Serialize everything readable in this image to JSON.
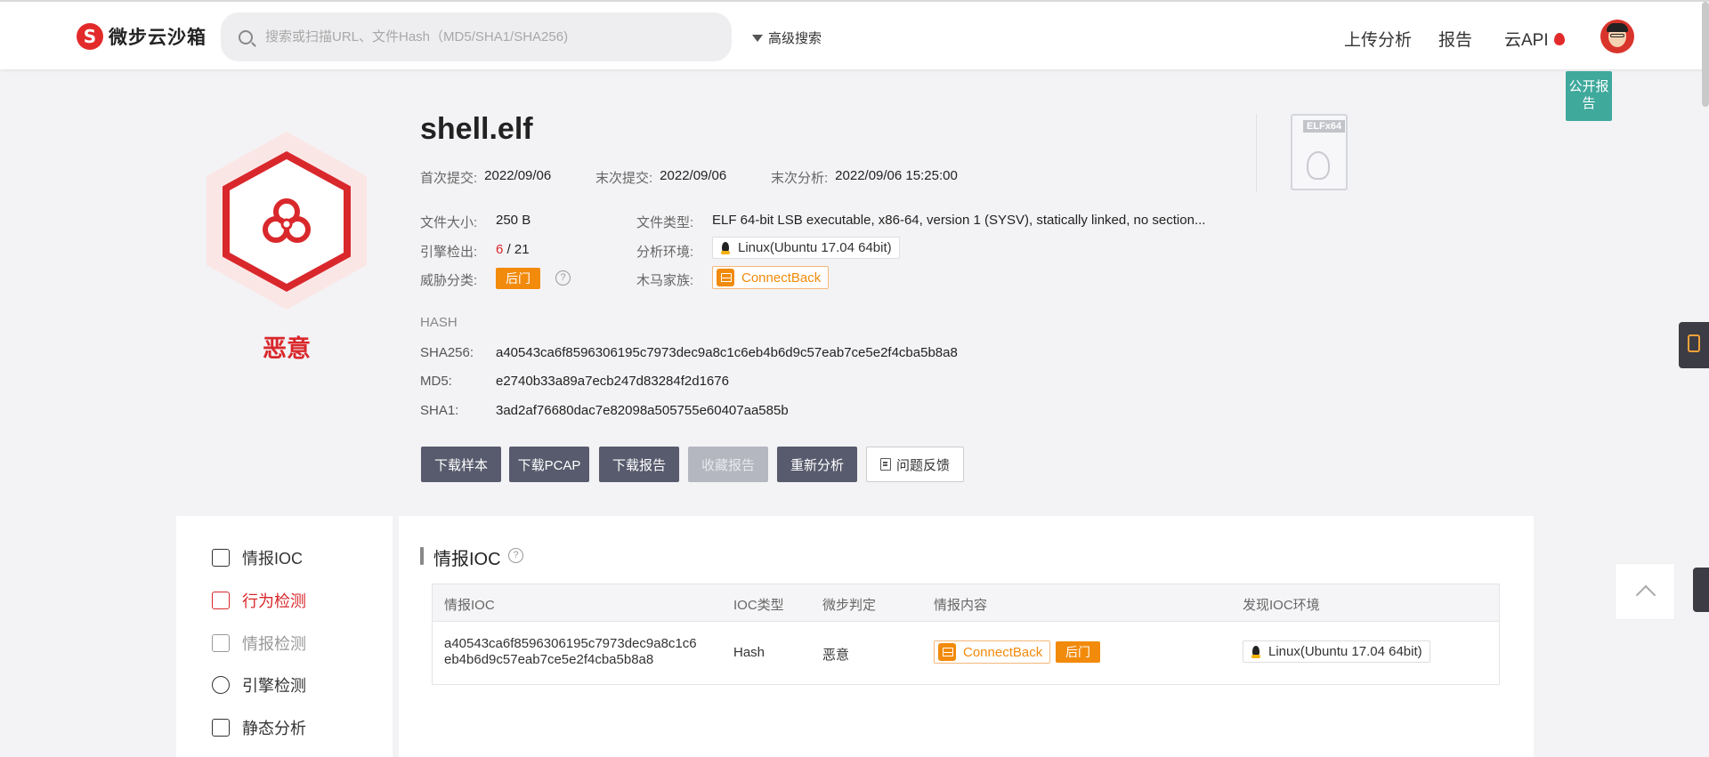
{
  "nav": {
    "logo_text": "微步云沙箱",
    "search_placeholder": "搜索或扫描URL、文件Hash（MD5/SHA1/SHA256)",
    "advanced_search": "高级搜索",
    "upload": "上传分析",
    "report": "报告",
    "api": "云API"
  },
  "public_badge": "公开报告",
  "file": {
    "name": "shell.elf",
    "verdict": "恶意",
    "first_submit_label": "首次提交:",
    "first_submit": "2022/09/06",
    "last_submit_label": "末次提交:",
    "last_submit": "2022/09/06",
    "last_analysis_label": "末次分析:",
    "last_analysis": "2022/09/06 15:25:00",
    "size_label": "文件大小:",
    "size": "250 B",
    "engine_label": "引擎检出:",
    "engine_detect": "6",
    "engine_total": " / 21",
    "threat_label": "威胁分类:",
    "threat": "后门",
    "type_label": "文件类型:",
    "type": "ELF 64-bit LSB executable, x86-64, version 1 (SYSV), statically linked, no section...",
    "env_label": "分析环境:",
    "env": "Linux(Ubuntu 17.04 64bit)",
    "family_label": "木马家族:",
    "family": "ConnectBack",
    "icon_badge": "ELFx64"
  },
  "hash": {
    "heading": "HASH",
    "sha256_label": "SHA256:",
    "sha256": "a40543ca6f8596306195c7973dec9a8c1c6eb4b6d9c57eab7ce5e2f4cba5b8a8",
    "md5_label": "MD5:",
    "md5": "e2740b33a89a7ecb247d83284f2d1676",
    "sha1_label": "SHA1:",
    "sha1": "3ad2af76680dac7e82098a505755e60407aa585b"
  },
  "actions": {
    "download_sample": "下载样本",
    "download_pcap": "下载PCAP",
    "download_report": "下载报告",
    "favorite_report": "收藏报告",
    "reanalyze": "重新分析",
    "feedback": "问题反馈"
  },
  "sidebar": {
    "items": [
      {
        "label": "情报IOC"
      },
      {
        "label": "行为检测"
      },
      {
        "label": "情报检测"
      },
      {
        "label": "引擎检测"
      },
      {
        "label": "静态分析"
      }
    ]
  },
  "ioc": {
    "title": "情报IOC",
    "columns": [
      "情报IOC",
      "IOC类型",
      "微步判定",
      "情报内容",
      "发现IOC环境"
    ],
    "rows": [
      {
        "ioc_line1": "a40543ca6f8596306195c7973dec9a8c1c6",
        "ioc_line2": "eb4b6d9c57eab7ce5e2f4cba5b8a8",
        "type": "Hash",
        "verdict": "恶意",
        "family": "ConnectBack",
        "tag": "后门",
        "env": "Linux(Ubuntu 17.04 64bit)"
      }
    ]
  },
  "colors": {
    "malicious": "#d9282c",
    "orange": "#f28a0b",
    "button_dark": "#585b6d",
    "public_badge": "#3fa99c"
  }
}
